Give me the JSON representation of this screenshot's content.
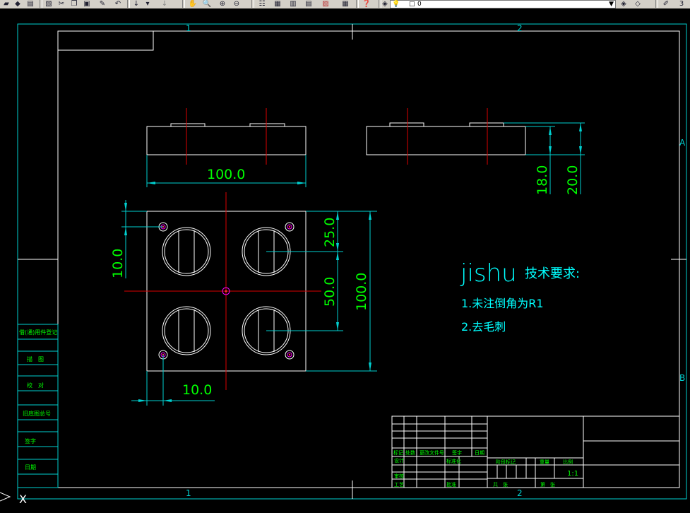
{
  "toolbar": {
    "icons": [
      "open-icon",
      "save-icon",
      "print-icon",
      "preview-icon",
      "cut-icon",
      "copy-icon",
      "paste-icon",
      "match-prop-icon",
      "undo-icon",
      "redo-icon",
      "pan-icon",
      "zoom-realtime-icon",
      "zoom-window-icon",
      "zoom-previous-icon",
      "properties-icon",
      "design-center-icon",
      "tool-palette-icon",
      "sheet-set-icon",
      "markup-icon",
      "calculator-icon",
      "help-icon",
      "layer-manager-icon",
      "layer-prev-icon",
      "layer-state-icon"
    ],
    "layer_value": "0",
    "right_value": "3"
  },
  "zones": {
    "col1": "1",
    "col2": "2",
    "rowA": "A",
    "rowB": "B"
  },
  "dimensions": {
    "top_width": "100.0",
    "right_h1": "18.0",
    "right_h2": "20.0",
    "left_offset": "10.0",
    "bottom_offset": "10.0",
    "hole_spacing_top": "25.0",
    "hole_spacing_mid": "50.0",
    "overall_height": "100.0"
  },
  "notes": {
    "title_prefix": "jishu",
    "title_main": "技术要求:",
    "line1": "1.未注倒角为R1",
    "line2": "2.去毛刺"
  },
  "side_table": {
    "rows": [
      "借(通)用件登记",
      "旧底图总号",
      "底图总号",
      "签字",
      "日期"
    ],
    "sign_rows": [
      "描　图",
      "校　对"
    ]
  },
  "title_block": {
    "labels_left": [
      "标记",
      "处数",
      "更改文件号",
      "签字",
      "日期"
    ],
    "design": "设计",
    "standard": "标准化",
    "check": "审核",
    "craft": "工艺",
    "approve": "批准",
    "stage": "阶段标记",
    "weight": "重量",
    "ratio_label": "比例",
    "ratio": "1:1",
    "sheets": "共　张",
    "sheet_no": "第　张"
  },
  "ucs_label": "X"
}
